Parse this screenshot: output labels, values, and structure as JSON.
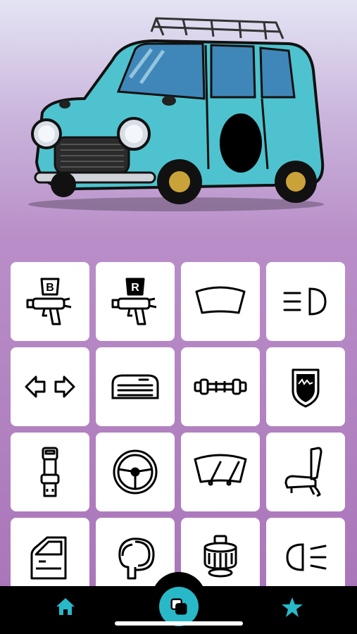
{
  "hero": {
    "image": "cartoon-mini-car",
    "car_color": "#4ec3cf"
  },
  "grid": {
    "tiles": [
      {
        "icon": "paint-gun-b-icon",
        "letter": "B"
      },
      {
        "icon": "paint-gun-r-icon",
        "letter": "R"
      },
      {
        "icon": "windshield-icon"
      },
      {
        "icon": "headlight-icon"
      },
      {
        "icon": "turn-signal-icon"
      },
      {
        "icon": "grille-icon"
      },
      {
        "icon": "axle-icon"
      },
      {
        "icon": "badge-emblem-icon"
      },
      {
        "icon": "seat-belt-icon"
      },
      {
        "icon": "steering-wheel-icon"
      },
      {
        "icon": "wiper-icon"
      },
      {
        "icon": "seat-icon"
      },
      {
        "icon": "door-icon"
      },
      {
        "icon": "side-mirror-icon"
      },
      {
        "icon": "fuel-cap-icon"
      },
      {
        "icon": "fog-light-icon"
      }
    ]
  },
  "tabbar": {
    "items": [
      {
        "icon": "home-icon"
      },
      {
        "icon": "layers-icon",
        "active": true
      },
      {
        "icon": "star-icon"
      }
    ],
    "accent": "#28b8c8"
  }
}
